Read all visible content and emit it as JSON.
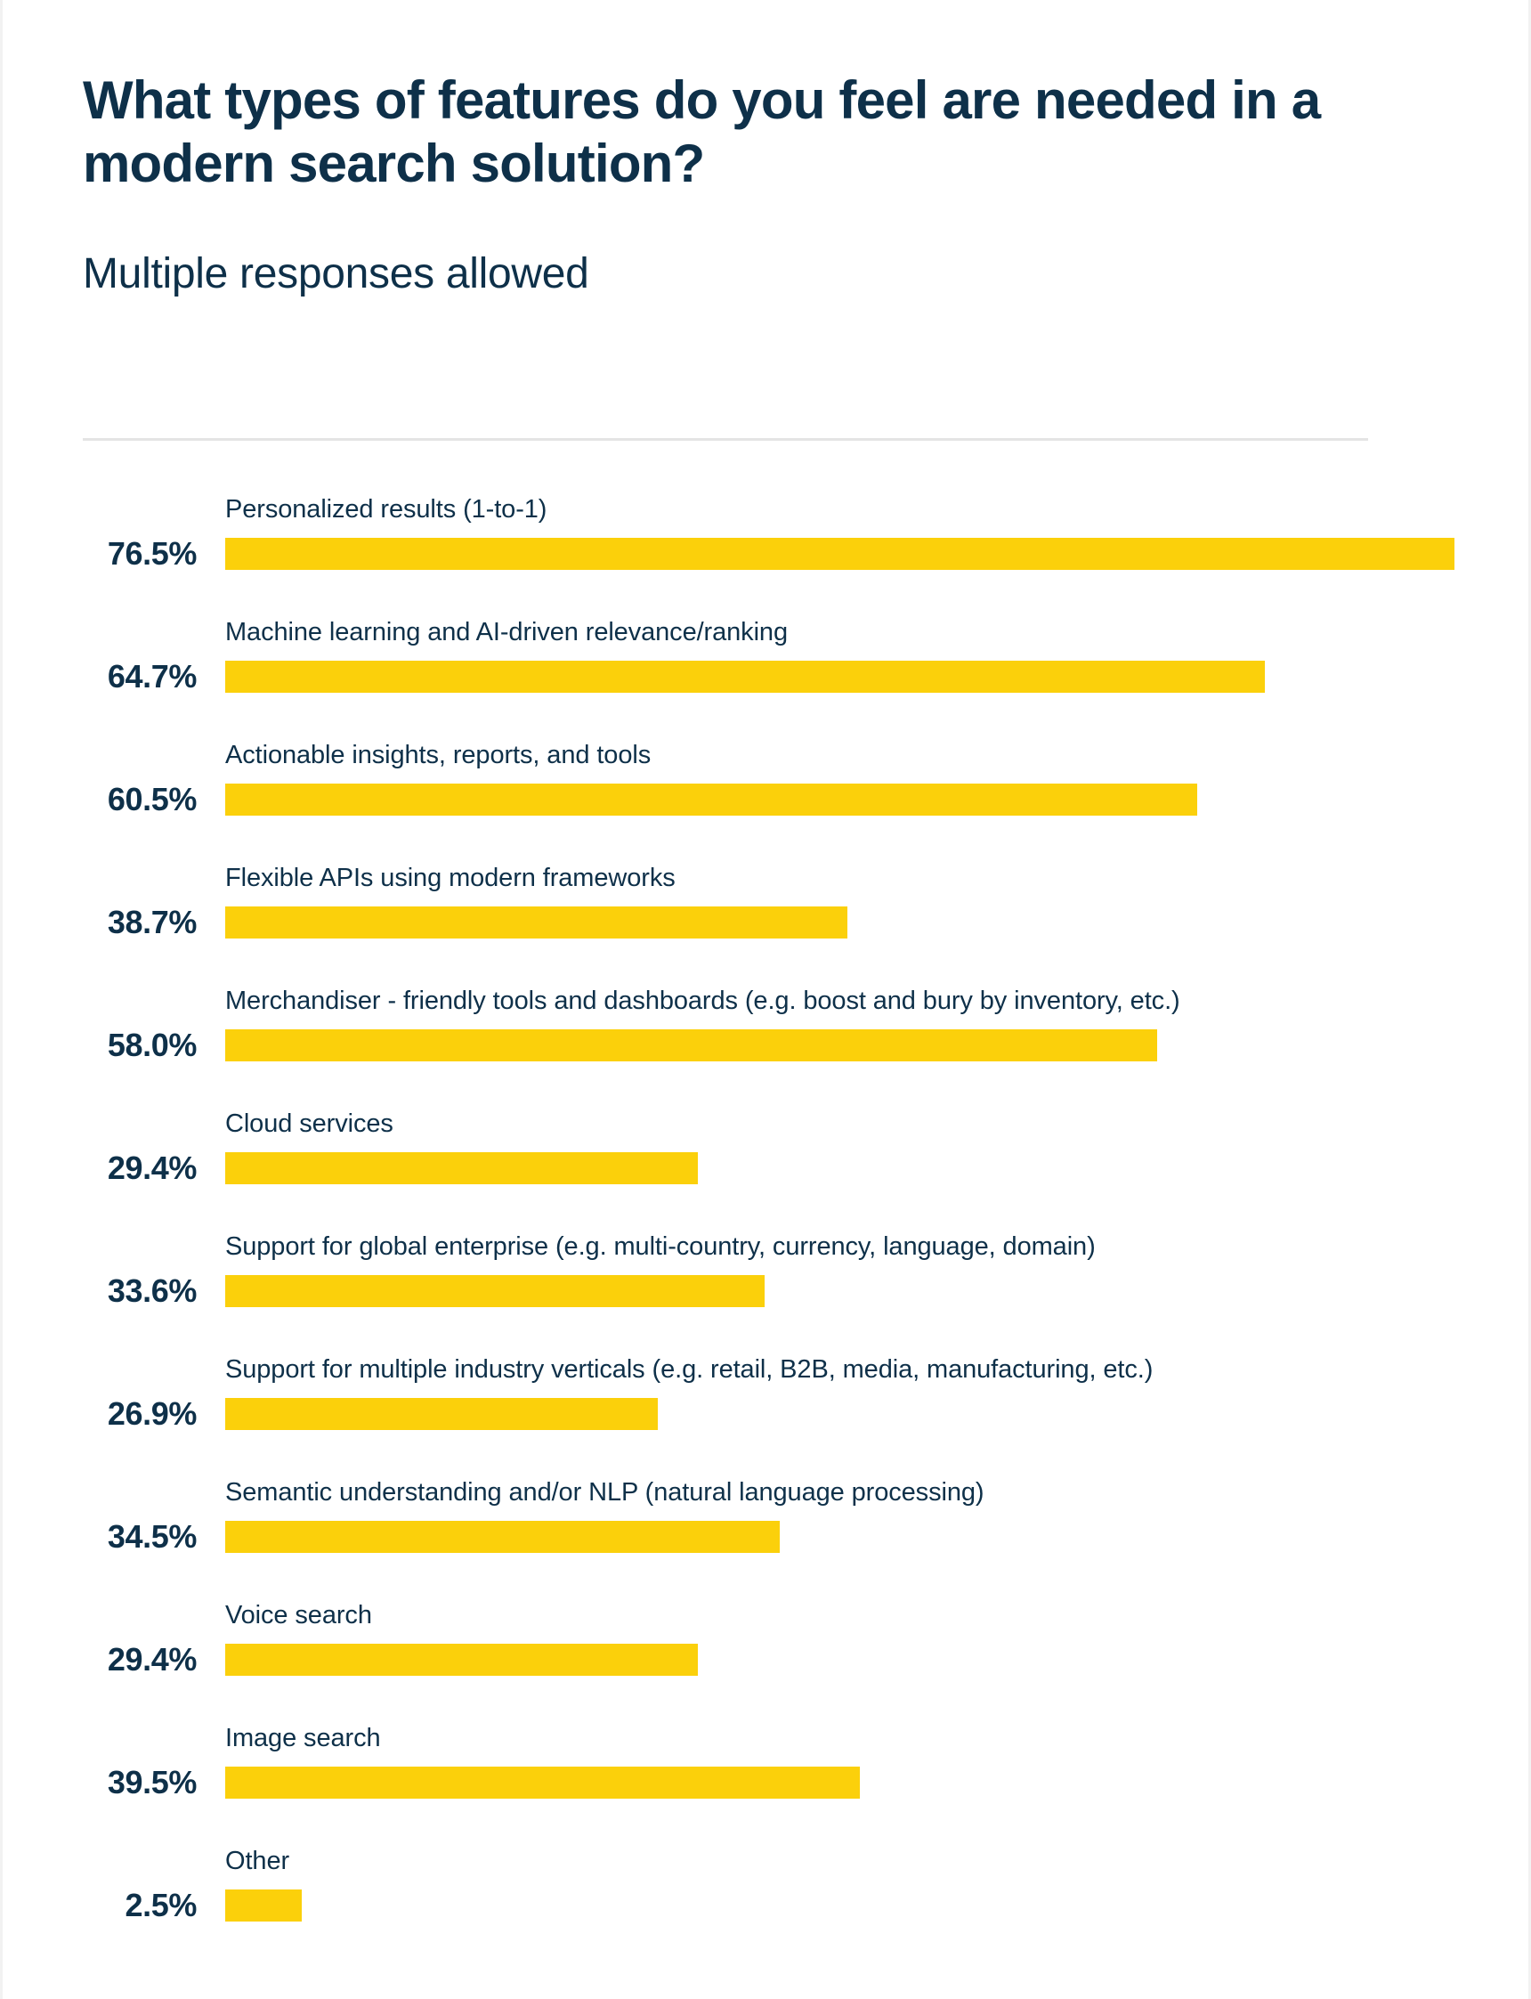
{
  "header": {
    "title": "What types of features do you feel are needed in a modern search solution?",
    "subtitle": "Multiple responses allowed"
  },
  "colors": {
    "bar": "#fbd00b",
    "text": "#0e3049",
    "divider": "#e4e4e4",
    "background": "#ffffff"
  },
  "chart_data": {
    "type": "bar",
    "orientation": "horizontal",
    "title": "What types of features do you feel are needed in a modern search solution?",
    "subtitle": "Multiple responses allowed",
    "xlabel": "",
    "ylabel": "",
    "xlim": [
      0,
      80
    ],
    "grid": false,
    "legend": null,
    "value_suffix": "%",
    "categories": [
      "Personalized results (1-to-1)",
      "Machine learning and AI-driven relevance/ranking",
      "Actionable insights, reports, and tools",
      "Flexible APIs using modern frameworks",
      "Merchandiser - friendly tools and dashboards (e.g. boost and bury by inventory, etc.)",
      "Cloud services",
      "Support for global enterprise (e.g. multi-country, currency, language, domain)",
      "Support for multiple industry verticals (e.g. retail, B2B, media, manufacturing, etc.)",
      "Semantic understanding and/or NLP (natural language processing)",
      "Voice search",
      "Image search",
      "Other"
    ],
    "values": [
      76.5,
      64.7,
      60.5,
      38.7,
      58.0,
      29.4,
      33.6,
      26.9,
      34.5,
      29.4,
      39.5,
      2.5
    ],
    "value_labels": [
      "76.5%",
      "64.7%",
      "60.5%",
      "38.7%",
      "58.0%",
      "29.4%",
      "33.6%",
      "26.9%",
      "34.5%",
      "29.4%",
      "39.5%",
      "2.5%"
    ]
  },
  "rows": [
    {
      "label": "Personalized results (1-to-1)",
      "value": 76.5,
      "value_label": "76.5%"
    },
    {
      "label": "Machine learning and AI-driven relevance/ranking",
      "value": 64.7,
      "value_label": "64.7%"
    },
    {
      "label": "Actionable insights, reports, and tools",
      "value": 60.5,
      "value_label": "60.5%"
    },
    {
      "label": "Flexible APIs using modern frameworks",
      "value": 38.7,
      "value_label": "38.7%"
    },
    {
      "label": "Merchandiser - friendly tools and dashboards (e.g. boost and bury by inventory, etc.)",
      "value": 58.0,
      "value_label": "58.0%"
    },
    {
      "label": "Cloud services",
      "value": 29.4,
      "value_label": "29.4%"
    },
    {
      "label": "Support for global enterprise (e.g. multi-country, currency, language, domain)",
      "value": 33.6,
      "value_label": "33.6%"
    },
    {
      "label": "Support for multiple industry verticals (e.g. retail, B2B, media, manufacturing, etc.)",
      "value": 26.9,
      "value_label": "26.9%"
    },
    {
      "label": "Semantic understanding and/or NLP (natural language processing)",
      "value": 34.5,
      "value_label": "34.5%"
    },
    {
      "label": "Voice search",
      "value": 29.4,
      "value_label": "29.4%"
    },
    {
      "label": "Image search",
      "value": 39.5,
      "value_label": "39.5%"
    },
    {
      "label": "Other",
      "value": 2.5,
      "value_label": "2.5%"
    }
  ]
}
